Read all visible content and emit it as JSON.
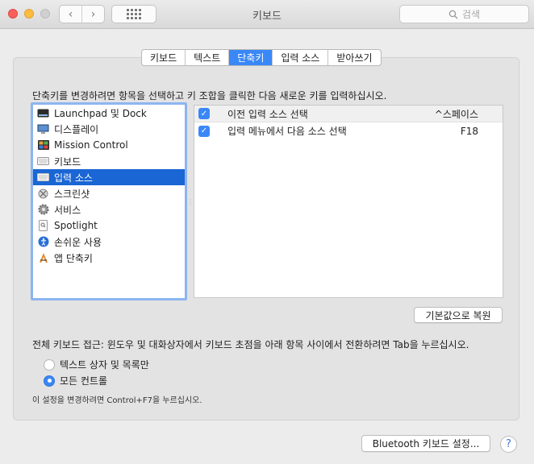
{
  "window": {
    "title": "키보드",
    "search_placeholder": "검색"
  },
  "tabs": [
    {
      "label": "키보드",
      "active": false
    },
    {
      "label": "텍스트",
      "active": false
    },
    {
      "label": "단축키",
      "active": true
    },
    {
      "label": "입력 소스",
      "active": false
    },
    {
      "label": "받아쓰기",
      "active": false
    }
  ],
  "instruction": "단축키를 변경하려면 항목을 선택하고 키 조합을 클릭한 다음 새로운 키를 입력하십시오.",
  "categories": [
    {
      "label": "Launchpad 및 Dock",
      "icon": "launchpad-dock-icon"
    },
    {
      "label": "디스플레이",
      "icon": "display-icon"
    },
    {
      "label": "Mission Control",
      "icon": "mission-control-icon"
    },
    {
      "label": "키보드",
      "icon": "keyboard-icon"
    },
    {
      "label": "입력 소스",
      "icon": "input-source-icon",
      "selected": true
    },
    {
      "label": "스크린샷",
      "icon": "screenshot-icon"
    },
    {
      "label": "서비스",
      "icon": "gear-icon"
    },
    {
      "label": "Spotlight",
      "icon": "spotlight-icon"
    },
    {
      "label": "손쉬운 사용",
      "icon": "accessibility-icon"
    },
    {
      "label": "앱 단축키",
      "icon": "app-shortcuts-icon"
    }
  ],
  "shortcuts": [
    {
      "checked": true,
      "name": "이전 입력 소스 선택",
      "key": "^스페이스"
    },
    {
      "checked": true,
      "name": "입력 메뉴에서 다음 소스 선택",
      "key": "F18"
    }
  ],
  "buttons": {
    "reset": "기본값으로 복원",
    "bluetooth": "Bluetooth 키보드 설정...",
    "help": "?"
  },
  "full_keyboard": {
    "label": "전체 키보드 접근: 윈도우 및 대화상자에서 키보드 초점을 아래 항목 사이에서 전환하려면 Tab을 누르십시오.",
    "options": [
      {
        "label": "텍스트 상자 및 목록만",
        "selected": false
      },
      {
        "label": "모든 컨트롤",
        "selected": true
      }
    ],
    "note": "이 설정을 변경하려면 Control+F7을 누르십시오."
  },
  "colors": {
    "accent": "#3a87f7",
    "selection": "#1a66d4"
  }
}
